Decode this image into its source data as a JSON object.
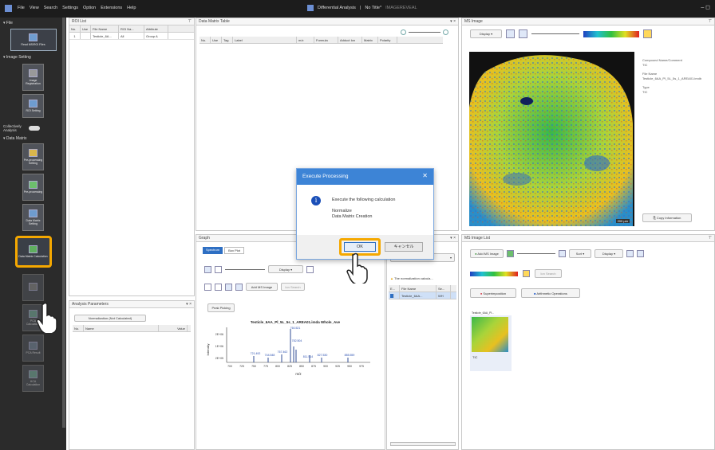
{
  "titlebar": {
    "menu": [
      "File",
      "View",
      "Search",
      "Settings",
      "Option",
      "Extensions",
      "Help"
    ],
    "title": "Differential Analysis",
    "file": "No Title*",
    "suffix": "IMAGEREVEAL"
  },
  "sidebar": {
    "file_header": "File",
    "read_file_label": "Read MS/ROI Files",
    "image_setting_header": "Image Setting",
    "image_registration": "Image Registration",
    "roi_setting": "ROI Setting",
    "collectively_analysis": "Collectively Analysis",
    "data_matrix_header": "Data Matrix",
    "preprocessing_setting": "Pre-processing Setting",
    "preprocessing": "Pre-processing",
    "data_matrix_setting": "Data Matrix Setting",
    "data_matrix_calculation": "Data Matrix Calculation",
    "pca_calculation": "PCA Calculation",
    "pca_result": "PCA Result",
    "hca_calculation": "HCA Calculation"
  },
  "roi_list": {
    "title": "ROI List",
    "columns": [
      "No.",
      "Use",
      "File Name",
      "ROI Na...",
      "Attribute"
    ],
    "rows": [
      [
        "1",
        "",
        "Testicle_6A...",
        "All",
        "Group A"
      ]
    ]
  },
  "analysis_params": {
    "title": "Analysis Parameters",
    "status": "Normalization (Not Calculated)",
    "columns": [
      "No.",
      "Name",
      "Value"
    ]
  },
  "data_matrix": {
    "title": "Data Matrix Table",
    "columns": [
      "No.",
      "Use",
      "Tag",
      "Label",
      "m/z",
      "Formula",
      "Adduct Ion",
      "Matrix",
      "Polarity"
    ]
  },
  "graph": {
    "title": "Graph",
    "tabs": [
      "Spectrum",
      "Box Plot"
    ],
    "display_label": "Display",
    "add_ms_image": "Add MS Image",
    "ion_search": "Ion Search",
    "peak_picking": "Peak Picking",
    "spectrum_title": "Testicle_6AA_Pl_5L_5s_1_AREA01.imda Whole_Ave",
    "ylabel": "Intensity",
    "xlabel": "m/z",
    "yticks": [
      "2E+06",
      "1E+06",
      "2E+05"
    ],
    "xticks": [
      "700",
      "725",
      "750",
      "775",
      "800",
      "825",
      "850",
      "875",
      "900",
      "925",
      "950",
      "975"
    ],
    "peak_labels": [
      "760.521",
      "782.504",
      "721.492",
      "744.548",
      "767.462",
      "811.514",
      "827.530",
      "885.559"
    ]
  },
  "file_panel": {
    "file_select": "File",
    "message": "The normalization calcula...",
    "columns": [
      "E...",
      "File Name",
      "Se..."
    ],
    "rows": [
      [
        "",
        "Testicle_6AA...",
        "WH"
      ]
    ]
  },
  "ms_image": {
    "title": "MS Image",
    "display_label": "Display",
    "compound_label": "Compound Name/Comment",
    "compound_value": "TIC",
    "file_name_label": "File Name",
    "file_name_value": "Testicle_6AA_PI_5L_5s_1_AREA01.imdb",
    "type_label": "Type",
    "type_value": "TIC",
    "copy_info": "Copy Information",
    "scale_label": "200 µm"
  },
  "ms_image_list": {
    "title": "MS Image List",
    "add_ms_image": "Add MS Image",
    "sort": "Sort",
    "display": "Display",
    "ion_search": "Ion Search",
    "superimposition": "Superimposition",
    "arithmetic": "Arithmetic Operations",
    "thumb_title": "Testicle_6AA_Pl...",
    "thumb_caption": "TIC"
  },
  "dialog": {
    "title": "Execute Processing",
    "message": "Execute the following calculation",
    "items": [
      "Normalize",
      "Data Matrix Creation"
    ],
    "ok": "OK",
    "cancel": "キャンセル"
  },
  "colors": {
    "accent": "#2e6fc3",
    "highlight": "#f5a800",
    "dialog_title": "#3d84d6"
  }
}
